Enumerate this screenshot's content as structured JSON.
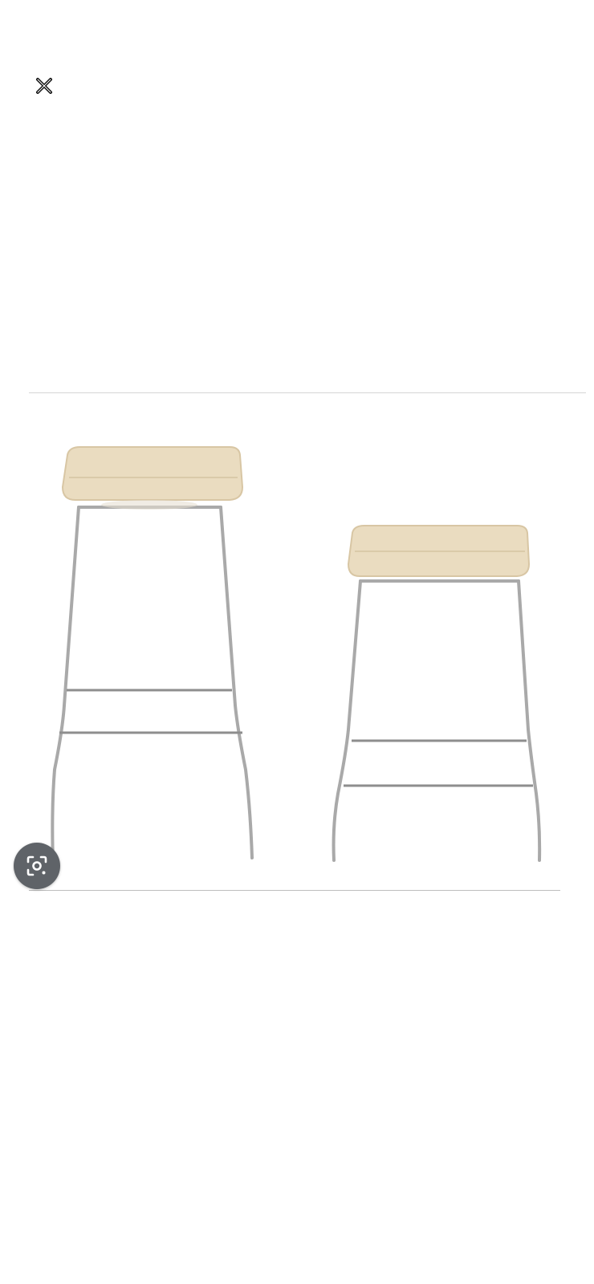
{
  "viewer": {
    "close_icon": "close-x-icon",
    "lens_icon": "lens-search-icon",
    "image": {
      "subject": "two-bar-stools",
      "colors": {
        "seat": "#eadcc0",
        "seat_edge": "#d8c6a4",
        "frame": "#a9a9a9",
        "background": "#ffffff"
      }
    }
  }
}
